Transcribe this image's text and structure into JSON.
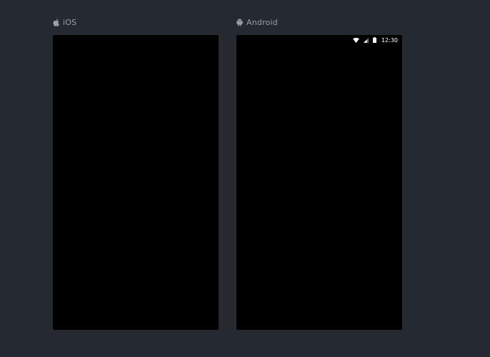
{
  "platforms": {
    "ios": {
      "label": "iOS",
      "icon": "apple-icon"
    },
    "android": {
      "label": "Android",
      "icon": "android-icon",
      "statusbar": {
        "time": "12:30",
        "icons": [
          "wifi-icon",
          "signal-icon",
          "battery-icon"
        ]
      }
    }
  },
  "colors": {
    "background": "#252a31",
    "label": "#98a0ab",
    "screen": "#000000",
    "status_text": "#ffffff"
  }
}
